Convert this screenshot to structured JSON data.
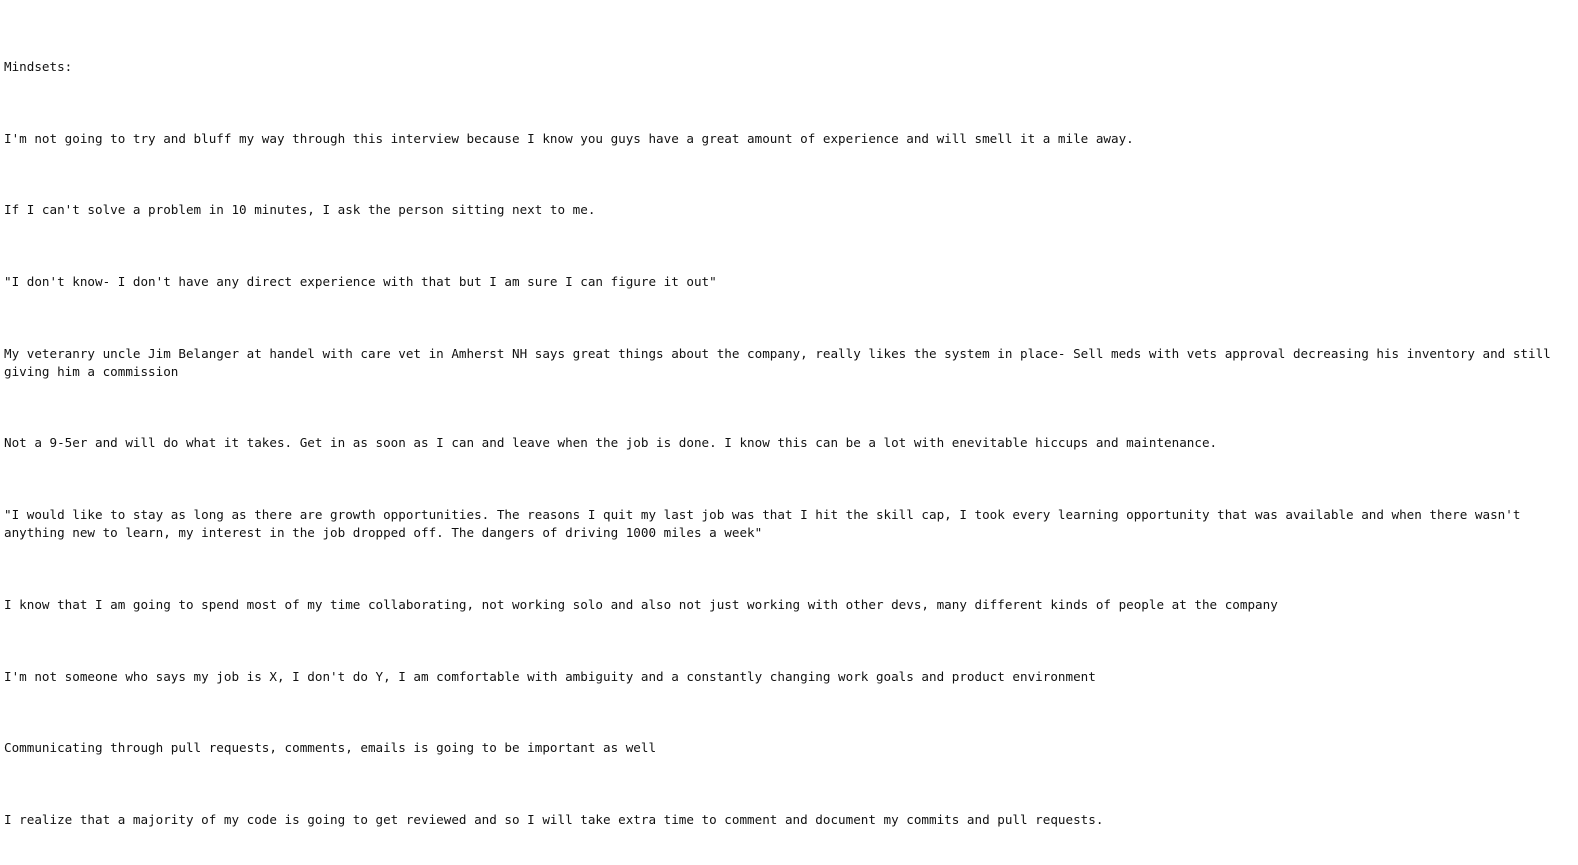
{
  "document": {
    "heading": "Mindsets:",
    "paragraphs": [
      "I'm not going to try and bluff my way through this interview because I know you guys have a great amount of experience and will smell it a mile away.",
      "If I can't solve a problem in 10 minutes, I ask the person sitting next to me.",
      "\"I don't know- I don't have any direct experience with that but I am sure I can figure it out\"",
      "My veteranry uncle Jim Belanger at handel with care vet in Amherst NH says great things about the company, really likes the system in place- Sell meds with vets approval decreasing his inventory and still giving him a commission",
      "Not a 9-5er and will do what it takes. Get in as soon as I can and leave when the job is done. I know this can be a lot with enevitable hiccups and maintenance.",
      "\"I would like to stay as long as there are growth opportunities. The reasons I quit my last job was that I hit the skill cap, I took every learning opportunity that was available and when there wasn't anything new to learn, my interest in the job dropped off. The dangers of driving 1000 miles a week\"",
      "I know that I am going to spend most of my time collaborating, not working solo and also not just working with other devs, many different kinds of people at the company",
      "I'm not someone who says my job is X, I don't do Y, I am comfortable with ambiguity and a constantly changing work goals and product environment",
      "Communicating through pull requests, comments, emails is going to be important as well",
      "I realize that a majority of my code is going to get reviewed and so I will take extra time to comment and document my commits and pull requests."
    ]
  }
}
